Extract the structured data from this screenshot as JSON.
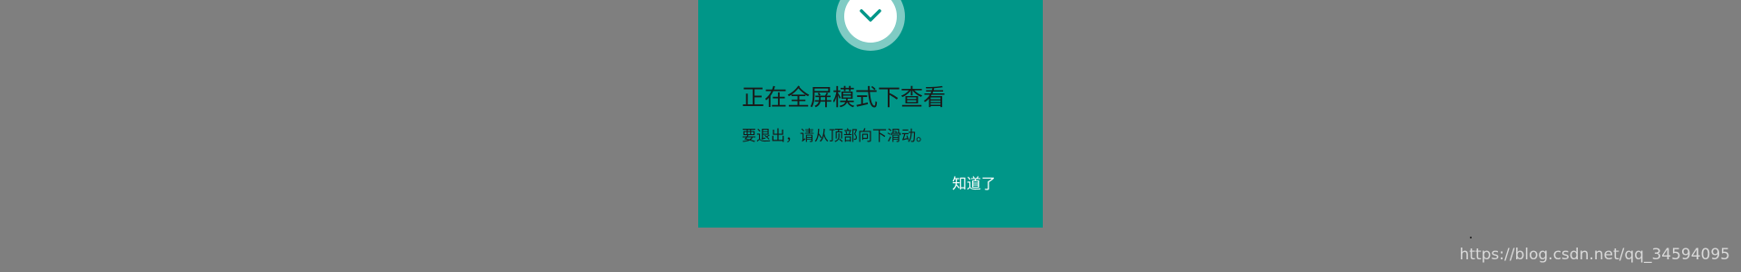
{
  "dialog": {
    "title": "正在全屏模式下查看",
    "message": "要退出，请从顶部向下滑动。",
    "ok_label": "知道了",
    "icon": "chevron-down-icon"
  },
  "watermark": {
    "text": "https://blog.csdn.net/qq_34594095"
  },
  "colors": {
    "background": "#7f7f7f",
    "dialog": "#009688",
    "badge_ring": "#80cbc4",
    "badge_inner": "#ffffff",
    "chevron": "#009688",
    "text_dark": "#1a1a1a",
    "button_text": "#ffffff"
  }
}
